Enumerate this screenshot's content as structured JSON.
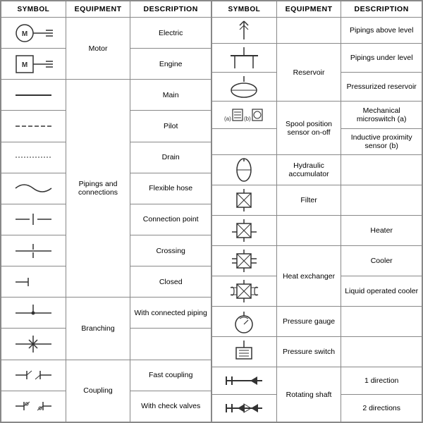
{
  "table1": {
    "headers": [
      "SYMBOL",
      "EQUIPMENT",
      "DESCRIPTION"
    ],
    "rows": [
      {
        "symbol": "motor_electric",
        "equipment": "Motor",
        "description": "Electric",
        "eq_span": 2
      },
      {
        "symbol": "motor_engine",
        "equipment": null,
        "description": "Engine"
      },
      {
        "symbol": "line_main",
        "equipment": "Pipings and connections",
        "description": "Main",
        "eq_span": 7
      },
      {
        "symbol": "line_pilot",
        "equipment": null,
        "description": "Pilot"
      },
      {
        "symbol": "line_drain",
        "equipment": null,
        "description": "Drain"
      },
      {
        "symbol": "flexible_hose",
        "equipment": null,
        "description": "Flexible hose"
      },
      {
        "symbol": "connection_point",
        "equipment": null,
        "description": "Connection point"
      },
      {
        "symbol": "crossing",
        "equipment": null,
        "description": "Crossing"
      },
      {
        "symbol": "closed",
        "equipment": null,
        "description": "Closed"
      },
      {
        "symbol": "branching_main",
        "equipment": "Branching",
        "description": "With connected piping",
        "eq_span": 2
      },
      {
        "symbol": "branching_connected",
        "equipment": null,
        "description": null
      },
      {
        "symbol": "coupling_fast",
        "equipment": "Coupling",
        "description": "Fast coupling",
        "eq_span": 2
      },
      {
        "symbol": "coupling_check",
        "equipment": null,
        "description": "With check valves"
      }
    ]
  },
  "table2": {
    "headers": [
      "SYMBOL",
      "EQUIPMENT",
      "DESCRIPTION"
    ],
    "rows": [
      {
        "symbol": "pipings_above",
        "equipment": null,
        "description": "Pipings above level",
        "eq_span": 3
      },
      {
        "symbol": "reservoir",
        "equipment": "Reservoir",
        "description": "Pipings under level",
        "eq_span": 2
      },
      {
        "symbol": "reservoir2",
        "equipment": null,
        "description": "Pressurized reservoir"
      },
      {
        "symbol": "spool_sensor",
        "equipment": "Spool position sensor on-off",
        "description": "Mechanical microswitch (a)",
        "eq_span": 2
      },
      {
        "symbol": "spool_sensor2",
        "equipment": null,
        "description": "Inductive proximity sensor (b)"
      },
      {
        "symbol": "hydraulic_acc",
        "equipment": "Hydraulic accumulator",
        "description": null,
        "eq_span": 1,
        "desc_span": 1
      },
      {
        "symbol": "filter",
        "equipment": "Filter",
        "description": null
      },
      {
        "symbol": "heater",
        "equipment": null,
        "description": "Heater",
        "eq_span": 3
      },
      {
        "symbol": "heat_exchanger",
        "equipment": "Heat exchanger",
        "description": "Cooler",
        "eq_span": 2
      },
      {
        "symbol": "heat_exchanger2",
        "equipment": null,
        "description": "Liquid operated cooler"
      },
      {
        "symbol": "pressure_gauge",
        "equipment": "Pressure gauge",
        "description": null
      },
      {
        "symbol": "pressure_switch",
        "equipment": "Pressure switch",
        "description": null
      },
      {
        "symbol": "rotating_shaft1",
        "equipment": "Rotating shaft",
        "description": "1 direction",
        "eq_span": 2
      },
      {
        "symbol": "rotating_shaft2",
        "equipment": null,
        "description": "2 directions"
      }
    ]
  }
}
